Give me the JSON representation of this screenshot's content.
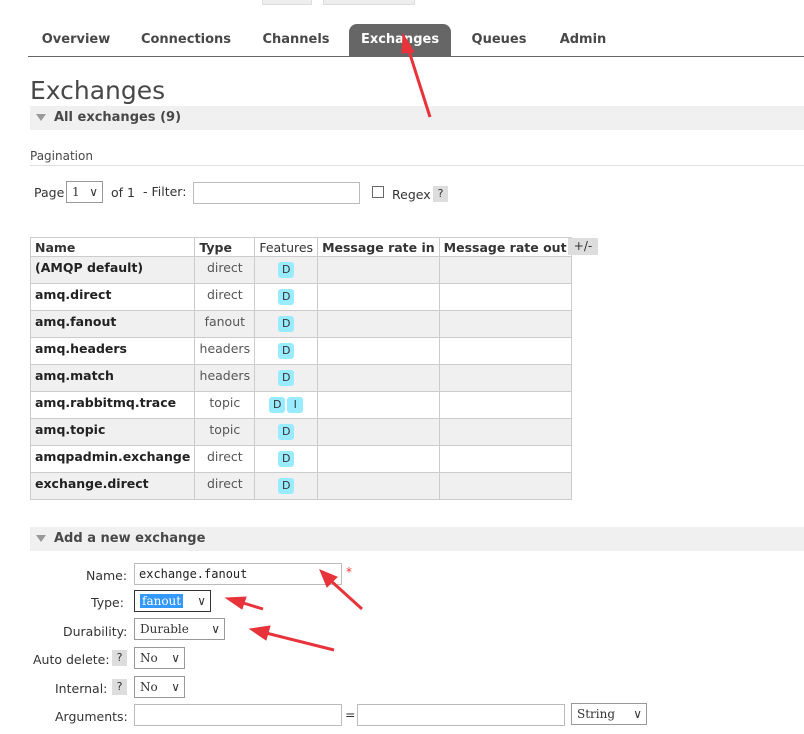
{
  "nav": {
    "tabs": [
      "Overview",
      "Connections",
      "Channels",
      "Exchanges",
      "Queues",
      "Admin"
    ],
    "active": "Exchanges"
  },
  "page_title": "Exchanges",
  "all_exchanges": {
    "label": "All exchanges (9)"
  },
  "pagination": {
    "section_label": "Pagination",
    "page_label": "Page",
    "page_value": "1",
    "of_label": "of 1",
    "filter_label": "- Filter:",
    "filter_value": "",
    "regex_label": "Regex",
    "help": "?"
  },
  "table": {
    "headers": [
      "Name",
      "Type",
      "Features",
      "Message rate in",
      "Message rate out"
    ],
    "toggle_columns": "+/-",
    "rows": [
      {
        "name": "(AMQP default)",
        "type": "direct",
        "features": [
          "D"
        ]
      },
      {
        "name": "amq.direct",
        "type": "direct",
        "features": [
          "D"
        ]
      },
      {
        "name": "amq.fanout",
        "type": "fanout",
        "features": [
          "D"
        ]
      },
      {
        "name": "amq.headers",
        "type": "headers",
        "features": [
          "D"
        ]
      },
      {
        "name": "amq.match",
        "type": "headers",
        "features": [
          "D"
        ]
      },
      {
        "name": "amq.rabbitmq.trace",
        "type": "topic",
        "features": [
          "D",
          "I"
        ]
      },
      {
        "name": "amq.topic",
        "type": "topic",
        "features": [
          "D"
        ]
      },
      {
        "name": "amqpadmin.exchange",
        "type": "direct",
        "features": [
          "D"
        ]
      },
      {
        "name": "exchange.direct",
        "type": "direct",
        "features": [
          "D"
        ]
      }
    ]
  },
  "add_exchange": {
    "header": "Add a new exchange",
    "name_label": "Name:",
    "name_value": "exchange.fanout",
    "required_mark": "*",
    "type_label": "Type:",
    "type_value": "fanout",
    "durability_label": "Durability:",
    "durability_value": "Durable",
    "auto_delete_label": "Auto delete:",
    "auto_delete_value": "No",
    "internal_label": "Internal:",
    "internal_value": "No",
    "arguments_label": "Arguments:",
    "arguments_equals": "=",
    "arguments_type_value": "String",
    "help": "?"
  },
  "colors": {
    "nav_active_bg": "#666666",
    "badge_bg": "#99ebff",
    "arrow": "#e8333a",
    "selected_option": "#3399ff"
  },
  "icons": {
    "collapse": "triangle-down-icon",
    "select": "chevron-down-icon"
  }
}
